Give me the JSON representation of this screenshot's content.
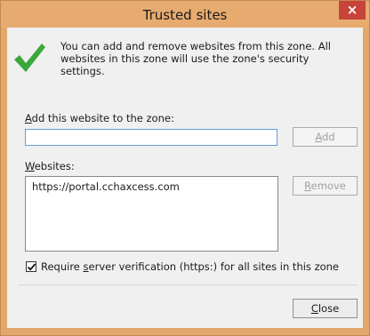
{
  "dialog": {
    "title": "Trusted sites",
    "close_glyph": "×",
    "info_text": "You can add and remove websites from this zone. All websites in this zone will use the zone's security settings.",
    "add_label_u": "A",
    "add_label_rest": "dd this website to the zone:",
    "add_input_value": "",
    "add_button_u": "A",
    "add_button_rest": "dd",
    "websites_label_u": "W",
    "websites_label_rest": "ebsites:",
    "websites": [
      "https://portal.cchaxcess.com"
    ],
    "remove_button_u": "R",
    "remove_button_rest": "emove",
    "require_checkbox_checked": true,
    "require_pre": "Require ",
    "require_u": "s",
    "require_rest": "erver verification (https:) for all sites in this zone",
    "close_button_u": "C",
    "close_button_rest": "lose"
  },
  "colors": {
    "frame": "#e3a66b",
    "close_button": "#c7443a",
    "check_green": "#3aa83a"
  },
  "icons": {
    "info": "checkmark-icon",
    "close": "close-icon"
  }
}
